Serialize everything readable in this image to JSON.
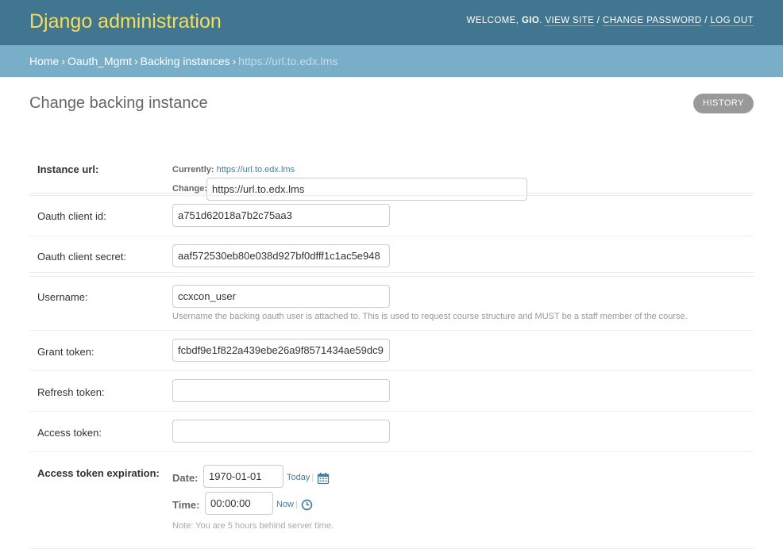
{
  "header": {
    "branding": "Django administration",
    "welcome": "WELCOME,",
    "username": "GIO",
    "view_site": "VIEW SITE",
    "change_password": "CHANGE PASSWORD",
    "log_out": "LOG OUT"
  },
  "breadcrumbs": {
    "home": "Home",
    "app": "Oauth_Mgmt",
    "model": "Backing instances",
    "current": "https://url.to.edx.lms"
  },
  "page": {
    "title": "Change backing instance",
    "history": "HISTORY"
  },
  "form": {
    "instance_url": {
      "label": "Instance url:",
      "currently_label": "Currently:",
      "currently_value": "https://url.to.edx.lms",
      "change_label": "Change:",
      "value": "https://url.to.edx.lms"
    },
    "oauth_client_id": {
      "label": "Oauth client id:",
      "value": "a751d62018a7b2c75aa3"
    },
    "oauth_client_secret": {
      "label": "Oauth client secret:",
      "value": "aaf572530eb80e038d927bf0dfff1c1ac5e948"
    },
    "username": {
      "label": "Username:",
      "value": "ccxcon_user",
      "help": "Username the backing oauth user is attached to. This is used to request course structure and MUST be a staff member of the course."
    },
    "grant_token": {
      "label": "Grant token:",
      "value": "fcbdf9e1f822a439ebe26a9f8571434ae59dc9"
    },
    "refresh_token": {
      "label": "Refresh token:",
      "value": ""
    },
    "access_token": {
      "label": "Access token:",
      "value": ""
    },
    "access_token_expiration": {
      "label": "Access token expiration:",
      "date_label": "Date:",
      "date_value": "1970-01-01",
      "today": "Today",
      "time_label": "Time:",
      "time_value": "00:00:00",
      "now": "Now",
      "note": "Note: You are 5 hours behind server time."
    }
  },
  "icons": {
    "calendar": "calendar-icon",
    "clock": "clock-icon"
  },
  "colors": {
    "header_bg": "#417690",
    "branding": "#f5dd5d",
    "breadcrumbs_bg": "#79aec8",
    "link": "#447e9b",
    "history_btn": "#999999"
  }
}
